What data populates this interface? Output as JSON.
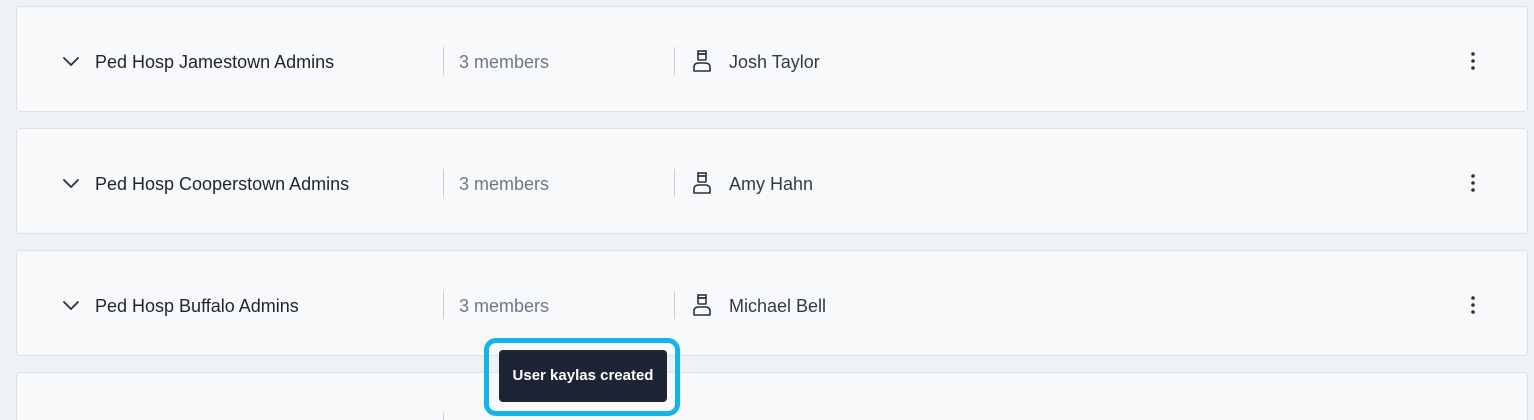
{
  "groups": [
    {
      "name": "Ped Hosp Jamestown Admins",
      "members": "3 members",
      "owner": "Josh Taylor"
    },
    {
      "name": "Ped Hosp Cooperstown Admins",
      "members": "3 members",
      "owner": "Amy Hahn"
    },
    {
      "name": "Ped Hosp Buffalo Admins",
      "members": "3 members",
      "owner": "Michael Bell"
    }
  ],
  "toast": {
    "message": "User kaylas created"
  },
  "icons": {
    "expand": "chevron-down-icon",
    "owner": "user-icon",
    "menu": "more-vertical-icon"
  },
  "colors": {
    "toast_background": "#1d2433",
    "highlight": "#13b4ea"
  }
}
